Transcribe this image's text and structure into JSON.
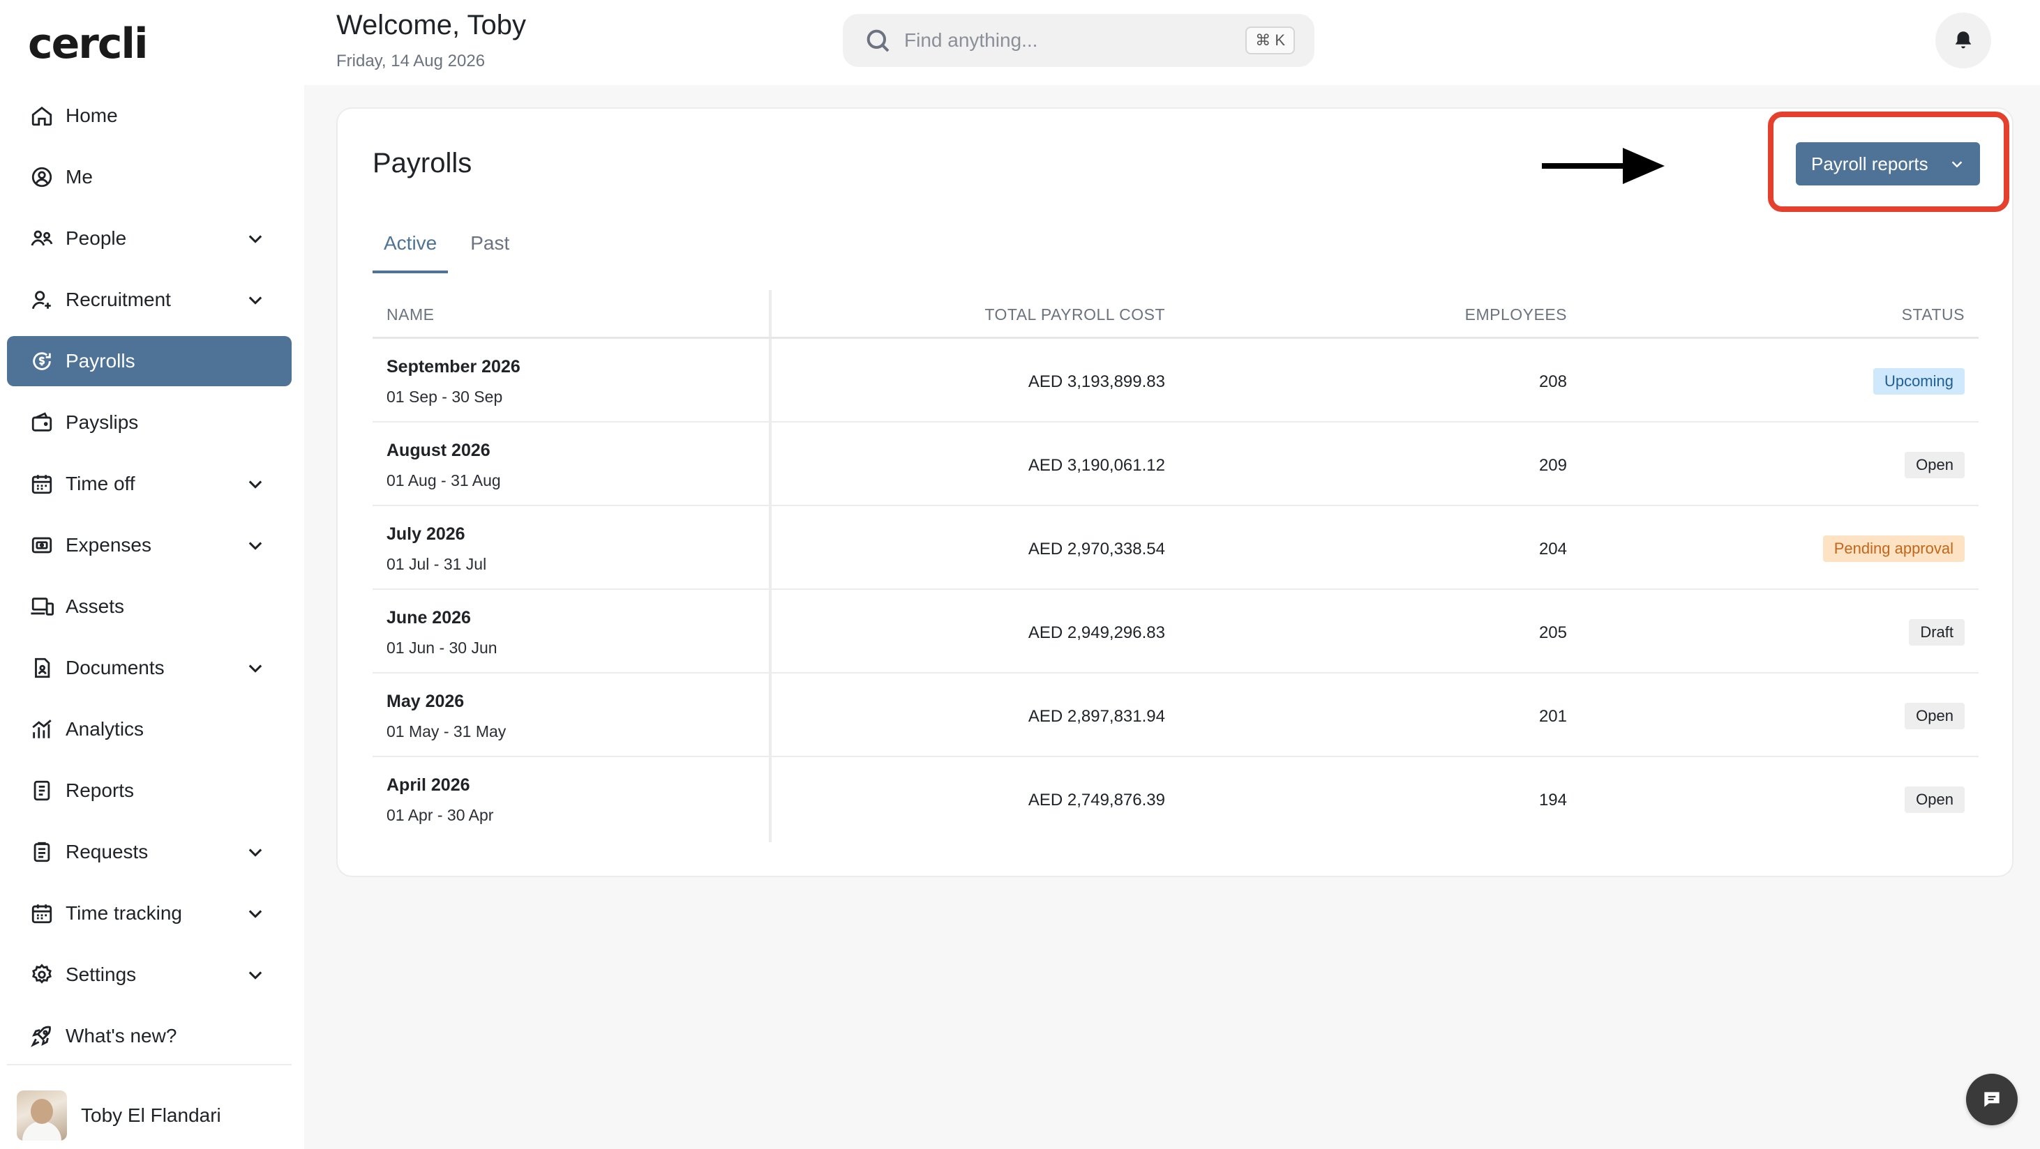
{
  "app": {
    "logo": "cercli"
  },
  "header": {
    "welcome": "Welcome, Toby",
    "date": "Friday, 14 Aug 2026",
    "search_placeholder": "Find anything...",
    "search_shortcut": "⌘ K"
  },
  "sidebar": {
    "items": [
      {
        "label": "Home",
        "icon": "home-icon"
      },
      {
        "label": "Me",
        "icon": "user-circle-icon"
      },
      {
        "label": "People",
        "icon": "people-icon",
        "expandable": true
      },
      {
        "label": "Recruitment",
        "icon": "user-add-icon",
        "expandable": true
      },
      {
        "label": "Payrolls",
        "icon": "payroll-icon",
        "active": true
      },
      {
        "label": "Payslips",
        "icon": "wallet-icon"
      },
      {
        "label": "Time off",
        "icon": "calendar-icon",
        "expandable": true
      },
      {
        "label": "Expenses",
        "icon": "receipt-icon",
        "expandable": true
      },
      {
        "label": "Assets",
        "icon": "devices-icon"
      },
      {
        "label": "Documents",
        "icon": "document-icon",
        "expandable": true
      },
      {
        "label": "Analytics",
        "icon": "analytics-icon"
      },
      {
        "label": "Reports",
        "icon": "report-icon"
      },
      {
        "label": "Requests",
        "icon": "clipboard-icon",
        "expandable": true
      },
      {
        "label": "Time tracking",
        "icon": "calendar-clock-icon",
        "expandable": true
      },
      {
        "label": "Settings",
        "icon": "gear-icon",
        "expandable": true
      },
      {
        "label": "What's new?",
        "icon": "rocket-icon"
      }
    ],
    "user": {
      "name": "Toby El Flandari"
    }
  },
  "payrolls": {
    "title": "Payrolls",
    "reports_button": "Payroll reports",
    "tabs": [
      {
        "label": "Active",
        "active": true
      },
      {
        "label": "Past",
        "active": false
      }
    ],
    "columns": {
      "name": "NAME",
      "cost": "TOTAL PAYROLL COST",
      "employees": "EMPLOYEES",
      "status": "STATUS"
    },
    "rows": [
      {
        "name": "September 2026",
        "range": "01 Sep - 30 Sep",
        "cost": "AED 3,193,899.83",
        "employees": "208",
        "status": "Upcoming"
      },
      {
        "name": "August 2026",
        "range": "01 Aug - 31 Aug",
        "cost": "AED 3,190,061.12",
        "employees": "209",
        "status": "Open"
      },
      {
        "name": "July 2026",
        "range": "01 Jul - 31 Jul",
        "cost": "AED 2,970,338.54",
        "employees": "204",
        "status": "Pending approval"
      },
      {
        "name": "June 2026",
        "range": "01 Jun - 30 Jun",
        "cost": "AED 2,949,296.83",
        "employees": "205",
        "status": "Draft"
      },
      {
        "name": "May 2026",
        "range": "01 May - 31 May",
        "cost": "AED 2,897,831.94",
        "employees": "201",
        "status": "Open"
      },
      {
        "name": "April 2026",
        "range": "01 Apr - 30 Apr",
        "cost": "AED 2,749,876.39",
        "employees": "194",
        "status": "Open"
      }
    ],
    "status_colors": {
      "Upcoming": {
        "bg": "#cfe8fb",
        "fg": "#1f5f95"
      },
      "Open": {
        "bg": "#eeeeee",
        "fg": "#1f2328"
      },
      "Pending approval": {
        "bg": "#fde3c3",
        "fg": "#c2661b"
      },
      "Draft": {
        "bg": "#eeeeee",
        "fg": "#1f2328"
      }
    }
  },
  "colors": {
    "accent": "#4f7396",
    "highlight": "#e5402e"
  }
}
